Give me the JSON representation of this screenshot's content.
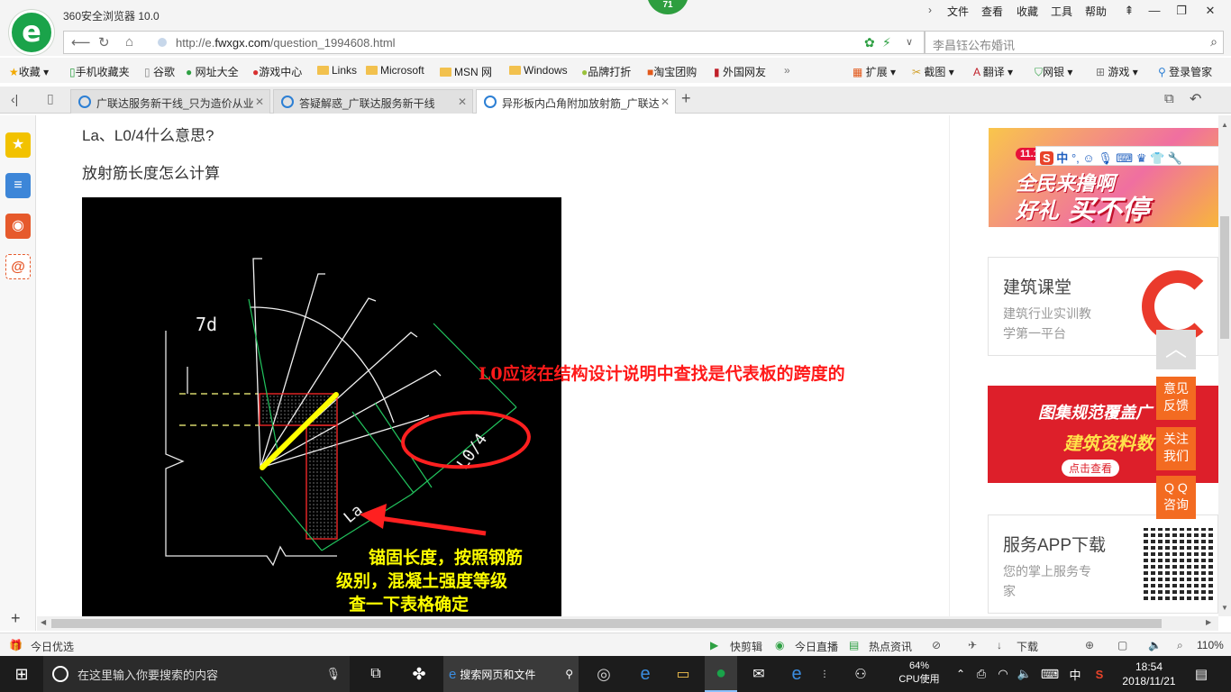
{
  "app": {
    "title": "360安全浏览器 10.0",
    "notification_count": "71",
    "menu": [
      "文件",
      "查看",
      "收藏",
      "工具",
      "帮助"
    ]
  },
  "address": {
    "url_prefix": "http://e.",
    "url_domain": "fwxgx.com",
    "url_path": "/question_1994608.html",
    "search_placeholder": "李昌钰公布婚讯"
  },
  "bookmarks": {
    "left": [
      "收藏",
      "手机收藏夹",
      "谷歌",
      "网址大全",
      "游戏中心",
      "Links",
      "Microsoft",
      "MSN 网",
      "Windows",
      "品牌打折",
      "淘宝团购",
      "外国网友"
    ],
    "right": [
      "扩展",
      "截图",
      "翻译",
      "网银",
      "游戏",
      "登录管家"
    ]
  },
  "tabs": [
    {
      "label": "广联达服务新干线_只为造价从业",
      "active": false
    },
    {
      "label": "答疑解惑_广联达服务新干线",
      "active": false
    },
    {
      "label": "异形板内凸角附加放射筋_广联达",
      "active": true
    }
  ],
  "question": {
    "line1": "La、L0/4什么意思?",
    "line2": "放射筋长度怎么计算"
  },
  "figure": {
    "label_7d": "7d",
    "label_l04": "L0/4",
    "label_la": "La",
    "annotation_l0": "L0应该在结构设计说明中查找是代表板的跨度的",
    "annotation_anchor": [
      "锚固长度，按照钢筋",
      "级别，混凝土强度等级",
      "查一下表格确定"
    ]
  },
  "right_column": {
    "ad1": {
      "tag": "11.1",
      "line1": "全民来撸啊",
      "line2": "好礼",
      "line3": "买不停"
    },
    "card1": {
      "title": "建筑课堂",
      "desc1": "建筑行业实训教",
      "desc2": "学第一平台"
    },
    "ad2": {
      "line1": "图集规范覆盖广",
      "line2": "建筑资料数",
      "button": "点击查看"
    },
    "card2": {
      "title": "服务APP下载",
      "desc1": "您的掌上服务专",
      "desc2": "家"
    },
    "float_tabs": [
      "意见\n反馈",
      "关注\n我们",
      "Q Q\n咨询"
    ]
  },
  "status": {
    "left": "今日优选",
    "items": [
      "快剪辑",
      "今日直播",
      "热点资讯",
      "下载"
    ],
    "zoom": "110%"
  },
  "taskbar": {
    "search_placeholder": "在这里输入你要搜索的内容",
    "web_search": "搜索网页和文件",
    "cpu_percent": "64%",
    "cpu_label": "CPU使用",
    "ime": "中",
    "time": "18:54",
    "date": "2018/11/21"
  },
  "colors": {
    "brand_green": "#1aa34a",
    "annotation_red": "#ff2020",
    "annotation_yellow": "#ffff00",
    "float_orange": "#f36b21"
  }
}
